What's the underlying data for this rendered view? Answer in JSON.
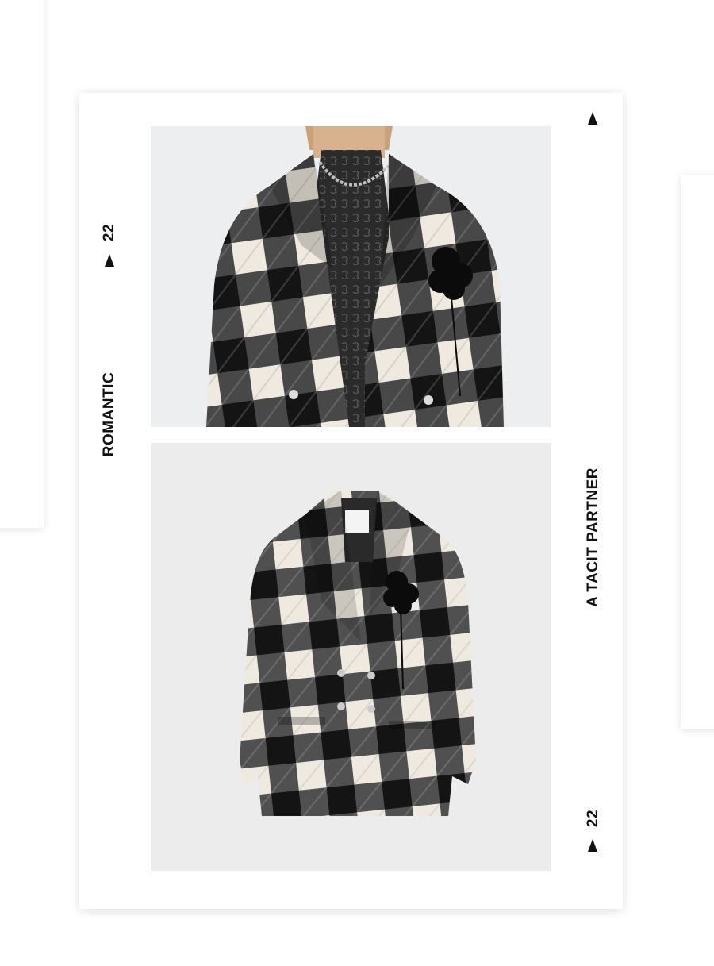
{
  "left_label": {
    "number": "22",
    "word": "ROMANTIC"
  },
  "right_label": {
    "number": "22",
    "phrase": "A TACIT PARTNER"
  },
  "icons": {
    "marker": "triangle-marker-icon"
  },
  "photos": {
    "top": "model-wearing-plaid-coat-photo",
    "bottom": "plaid-coat-product-photo"
  },
  "colors": {
    "plaid_dark": "#141414",
    "plaid_light": "#efe9df",
    "plaid_mid": "#7a7a7a",
    "page": "#ffffff"
  }
}
